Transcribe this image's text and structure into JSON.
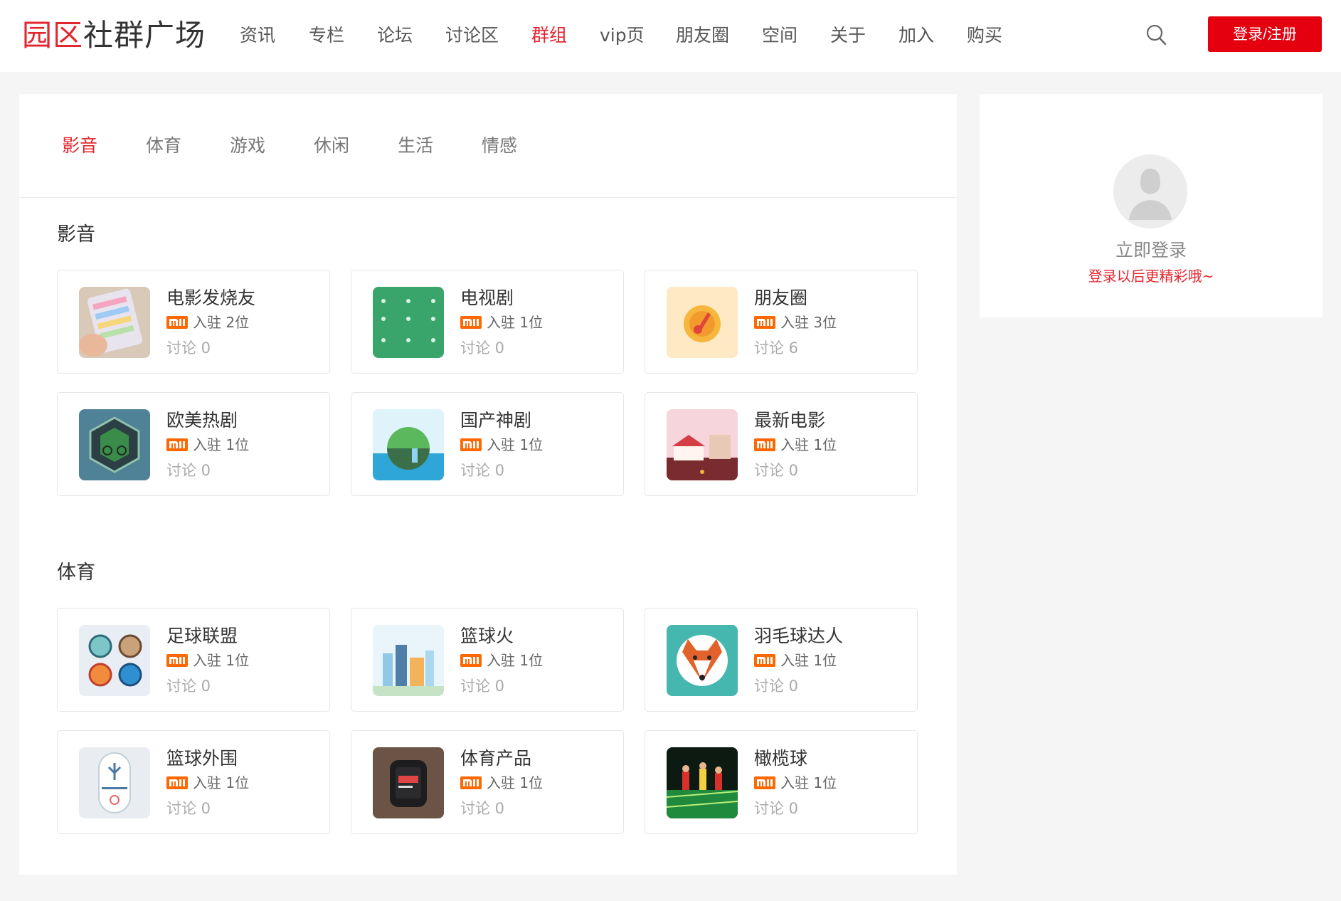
{
  "header": {
    "logo_red": "园区",
    "logo_black": "社群广场",
    "nav": [
      "资讯",
      "专栏",
      "论坛",
      "讨论区",
      "群组",
      "vip页",
      "朋友圈",
      "空间",
      "关于",
      "加入",
      "购买"
    ],
    "nav_active_index": 4,
    "login_label": "登录/注册",
    "search_icon": "search-icon"
  },
  "tabs": {
    "items": [
      "影音",
      "体育",
      "游戏",
      "休闲",
      "生活",
      "情感"
    ],
    "active_index": 0
  },
  "sections": [
    {
      "title": "影音",
      "groups": [
        {
          "name": "电影发烧友",
          "members": "入驻 2位",
          "discussions": "讨论 0"
        },
        {
          "name": "电视剧",
          "members": "入驻 1位",
          "discussions": "讨论 0"
        },
        {
          "name": "朋友圈",
          "members": "入驻 3位",
          "discussions": "讨论 6"
        },
        {
          "name": "欧美热剧",
          "members": "入驻 1位",
          "discussions": "讨论 0"
        },
        {
          "name": "国产神剧",
          "members": "入驻 1位",
          "discussions": "讨论 0"
        },
        {
          "name": "最新电影",
          "members": "入驻 1位",
          "discussions": "讨论 0"
        }
      ]
    },
    {
      "title": "体育",
      "groups": [
        {
          "name": "足球联盟",
          "members": "入驻 1位",
          "discussions": "讨论 0"
        },
        {
          "name": "篮球火",
          "members": "入驻 1位",
          "discussions": "讨论 0"
        },
        {
          "name": "羽毛球达人",
          "members": "入驻 1位",
          "discussions": "讨论 0"
        },
        {
          "name": "篮球外围",
          "members": "入驻 1位",
          "discussions": "讨论 0"
        },
        {
          "name": "体育产品",
          "members": "入驻 1位",
          "discussions": "讨论 0"
        },
        {
          "name": "橄榄球",
          "members": "入驻 1位",
          "discussions": "讨论 0"
        }
      ]
    }
  ],
  "side": {
    "login_now": "立即登录",
    "login_tip": "登录以后更精彩哦~"
  },
  "colors": {
    "accent": "#e4262e",
    "button": "#e4000f",
    "mi_logo": "#ff6700"
  }
}
